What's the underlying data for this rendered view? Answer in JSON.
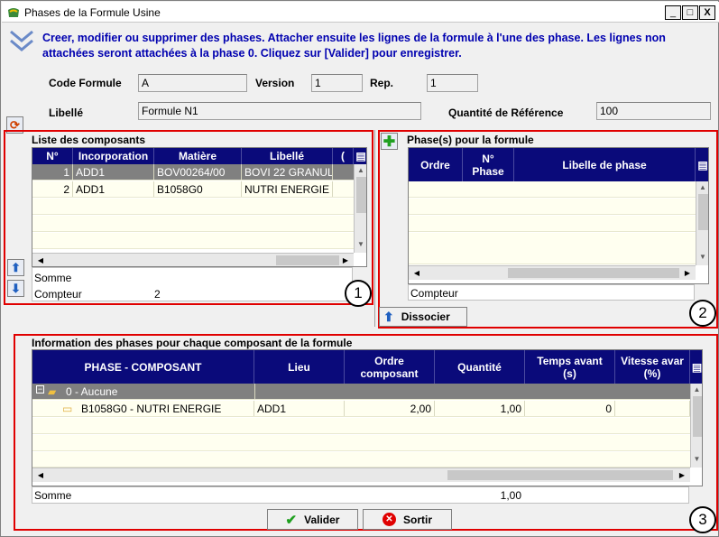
{
  "window": {
    "title": "Phases de la Formule Usine",
    "controls": [
      "_",
      "□",
      "X"
    ]
  },
  "instructions": "Creer, modifier ou supprimer des phases. Attacher ensuite les lignes de la formule à l'une des phase. Les lignes non attachées seront attachées à la phase 0. Cliquez sur [Valider] pour enregistrer.",
  "form": {
    "code_label": "Code Formule",
    "code_value": "A",
    "version_label": "Version",
    "version_value": "1",
    "rep_label": "Rep.",
    "rep_value": "1",
    "libelle_label": "Libellé",
    "libelle_value": "Formule N1",
    "quantite_label": "Quantité  de Référence",
    "quantite_value": "100"
  },
  "components": {
    "title": "Liste des composants",
    "headers": [
      "N°",
      "Incorporation",
      "Matière",
      "Libellé",
      "("
    ],
    "rows": [
      {
        "n": "1",
        "inc": "ADD1",
        "mat": "BOV00264/00",
        "lib": "BOVI 22 GRANUL"
      },
      {
        "n": "2",
        "inc": "ADD1",
        "mat": "B1058G0",
        "lib": "NUTRI ENERGIE"
      }
    ],
    "somme_label": "Somme",
    "compteur_label": "Compteur",
    "compteur_value": "2"
  },
  "phases": {
    "title": "Phase(s) pour la formule",
    "headers": [
      "Ordre",
      "N° Phase",
      "Libelle de phase"
    ],
    "compteur_label": "Compteur",
    "dissocier_label": "Dissocier"
  },
  "info": {
    "title": "Information des phases pour chaque composant de la formule",
    "headers": [
      "PHASE - COMPOSANT",
      "Lieu",
      "Ordre composant",
      "Quantité",
      "Temps avant (s)",
      "Vitesse avar (%)"
    ],
    "group_label": "0 - Aucune",
    "row": {
      "comp": "B1058G0 - NUTRI ENERGIE",
      "lieu": "ADD1",
      "ordre": "2,00",
      "qte": "1,00",
      "temps": "0"
    },
    "somme_label": "Somme",
    "somme_value": "1,00"
  },
  "buttons": {
    "valider": "Valider",
    "sortir": "Sortir"
  },
  "markers": [
    "1",
    "2",
    "3"
  ],
  "colors": {
    "grid_header": "#0a0a7a",
    "highlight_border": "#e00000",
    "instruction_text": "#0000b0"
  }
}
